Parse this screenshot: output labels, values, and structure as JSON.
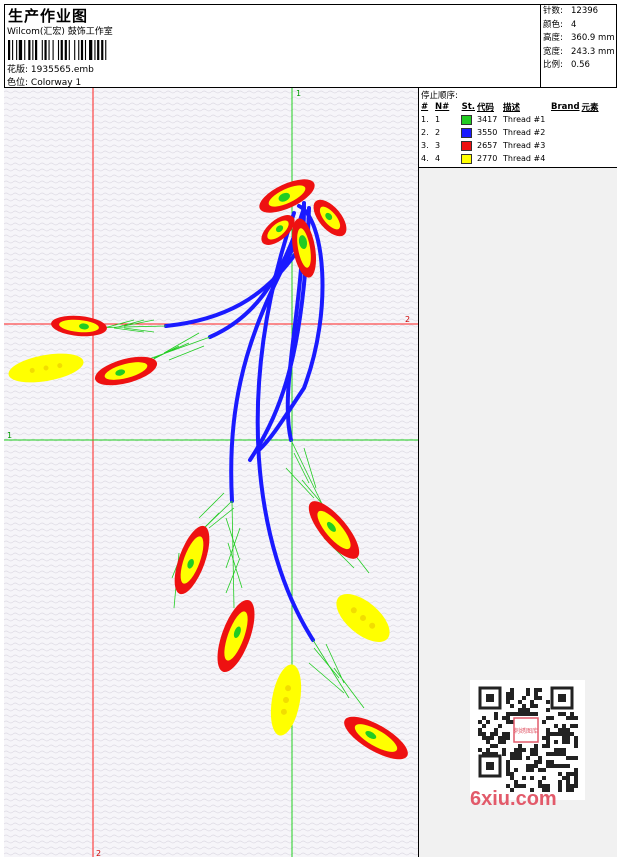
{
  "header": {
    "title": "生产作业图",
    "subtitle": "Wilcom(汇宏) 鼓饰工作室",
    "design_label": "花版:",
    "design_value": "1935565.emb",
    "colorway_label": "色位:",
    "colorway_value": "Colorway 1"
  },
  "stats": [
    {
      "label": "针数:",
      "value": "12396"
    },
    {
      "label": "颜色:",
      "value": "4"
    },
    {
      "label": "高度:",
      "value": "360.9 mm"
    },
    {
      "label": "宽度:",
      "value": "243.3 mm"
    },
    {
      "label": "比例:",
      "value": "0.56"
    }
  ],
  "legend": {
    "stop_order_label": "停止顺序:",
    "columns": [
      "#",
      "N#",
      "St.",
      "代码",
      "描述",
      "Brand",
      "元素"
    ],
    "rows": [
      {
        "idx": "1.",
        "n": "1",
        "color": "#22cc22",
        "code": "3417",
        "desc": "Thread #1"
      },
      {
        "idx": "2.",
        "n": "2",
        "color": "#1a1aff",
        "code": "3550",
        "desc": "Thread #2"
      },
      {
        "idx": "3.",
        "n": "3",
        "color": "#ee1111",
        "code": "2657",
        "desc": "Thread #3"
      },
      {
        "idx": "4.",
        "n": "4",
        "color": "#ffff00",
        "code": "2770",
        "desc": "Thread #4"
      }
    ]
  },
  "guides": {
    "vertical_red_label": "2",
    "vertical_green_label": "1",
    "horizontal_red_label": "2",
    "horizontal_green_label": "1"
  },
  "watermark": "6xiu.com",
  "qr_stamp": "刺绣图库"
}
